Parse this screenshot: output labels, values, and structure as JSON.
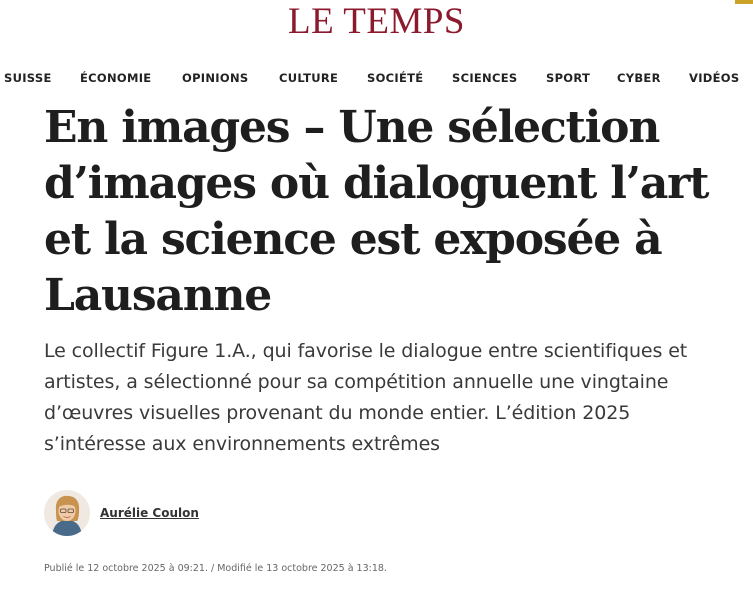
{
  "header": {
    "logo_text": "LE TEMPS",
    "brand_color": "#8c1a2e",
    "corner_accent_color": "#c9a227"
  },
  "nav": {
    "items": [
      {
        "label": "SUISSE"
      },
      {
        "label": "ÉCONOMIE"
      },
      {
        "label": "OPINIONS"
      },
      {
        "label": "CULTURE"
      },
      {
        "label": "SOCIÉTÉ"
      },
      {
        "label": "SCIENCES"
      },
      {
        "label": "SPORT"
      },
      {
        "label": "CYBER"
      },
      {
        "label": "VIDÉOS"
      }
    ]
  },
  "article": {
    "headline": "En images – Une sélection d’images où dialoguent l’art et la science est exposée à Lausanne",
    "lead": "Le collectif Figure 1.A., qui favorise le dialogue entre scientifiques et artistes, a sélectionné pour sa compétition annuelle une vingtaine d’œuvres visuelles provenant du monde entier. L’édition 2025 s’intéresse aux environnements extrêmes",
    "author": {
      "name": "Aurélie Coulon",
      "avatar_icon": "author-avatar-photo"
    },
    "dates": "Publié le 12 octobre 2025 à 09:21. / Modifié le 13 octobre 2025 à 13:18."
  }
}
